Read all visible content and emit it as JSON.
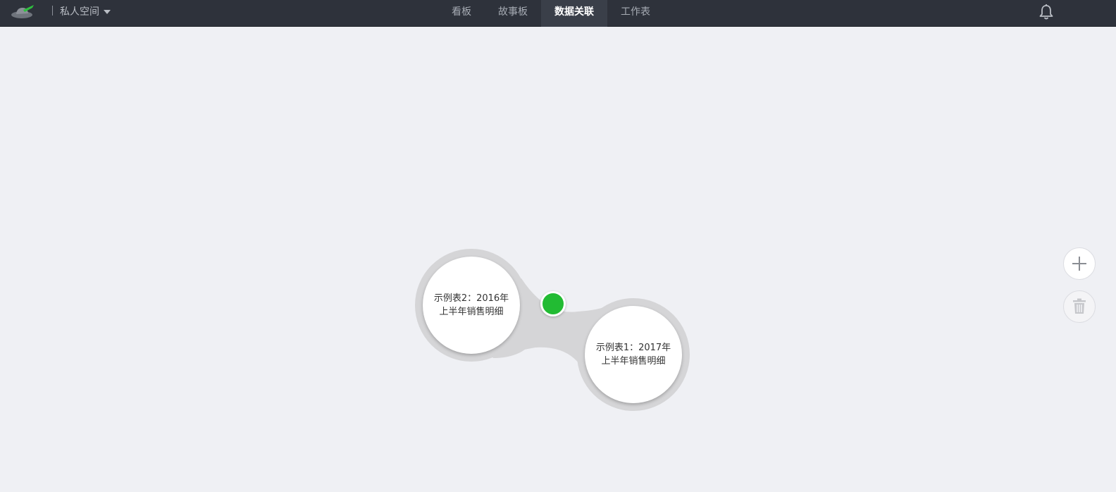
{
  "header": {
    "logo_icon": "hat-logo-icon",
    "space_label": "私人空间",
    "tabs": [
      {
        "label": "看板",
        "active": false
      },
      {
        "label": "故事板",
        "active": false
      },
      {
        "label": "数据关联",
        "active": true
      },
      {
        "label": "工作表",
        "active": false
      }
    ],
    "notification_icon": "bell-icon"
  },
  "graph": {
    "nodes": [
      {
        "label": "示例表2：2016年上半年销售明细"
      },
      {
        "label": "示例表1：2017年上半年销售明细"
      }
    ],
    "link_color": "#22bb33"
  },
  "side_actions": [
    {
      "icon": "plus-icon",
      "enabled": true
    },
    {
      "icon": "trash-icon",
      "enabled": false
    }
  ],
  "colors": {
    "topbar": "#2e323b",
    "canvas": "#eff0f4",
    "accent": "#22bb33"
  }
}
